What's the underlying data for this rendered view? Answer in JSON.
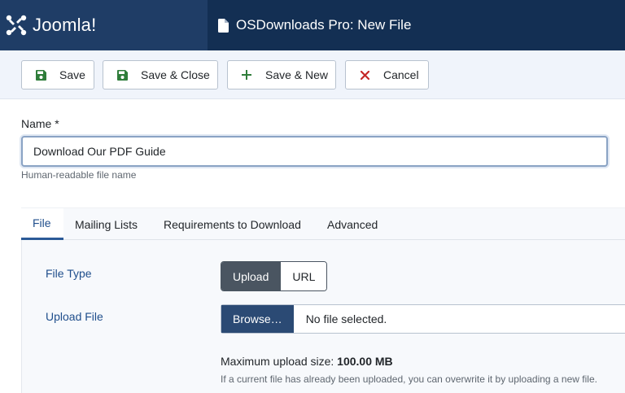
{
  "brand": {
    "name": "Joomla!"
  },
  "header": {
    "title": "OSDownloads Pro: New File",
    "title_icon": "file-icon"
  },
  "toolbar": {
    "save": "Save",
    "save_close": "Save & Close",
    "save_new": "Save & New",
    "cancel": "Cancel"
  },
  "name_field": {
    "label": "Name *",
    "value": "Download Our PDF Guide",
    "hint": "Human-readable file name"
  },
  "tabs": [
    {
      "label": "File",
      "active": true
    },
    {
      "label": "Mailing Lists",
      "active": false
    },
    {
      "label": "Requirements to Download",
      "active": false
    },
    {
      "label": "Advanced",
      "active": false
    }
  ],
  "file_tab": {
    "file_type_label": "File Type",
    "file_type_options": [
      "Upload",
      "URL"
    ],
    "file_type_selected": "Upload",
    "upload_label": "Upload File",
    "browse_label": "Browse…",
    "file_status": "No file selected.",
    "max_upload_label": "Maximum upload size:",
    "max_upload_value": "100.00 MB",
    "overwrite_note": "If a current file has already been uploaded, you can overwrite it by uploading a new file."
  },
  "colors": {
    "header_bg": "#132f53",
    "brand_bg": "#1f3d66",
    "accent": "#2b5a97",
    "cancel_icon": "#c52827",
    "save_icon": "#2f7d3a"
  }
}
